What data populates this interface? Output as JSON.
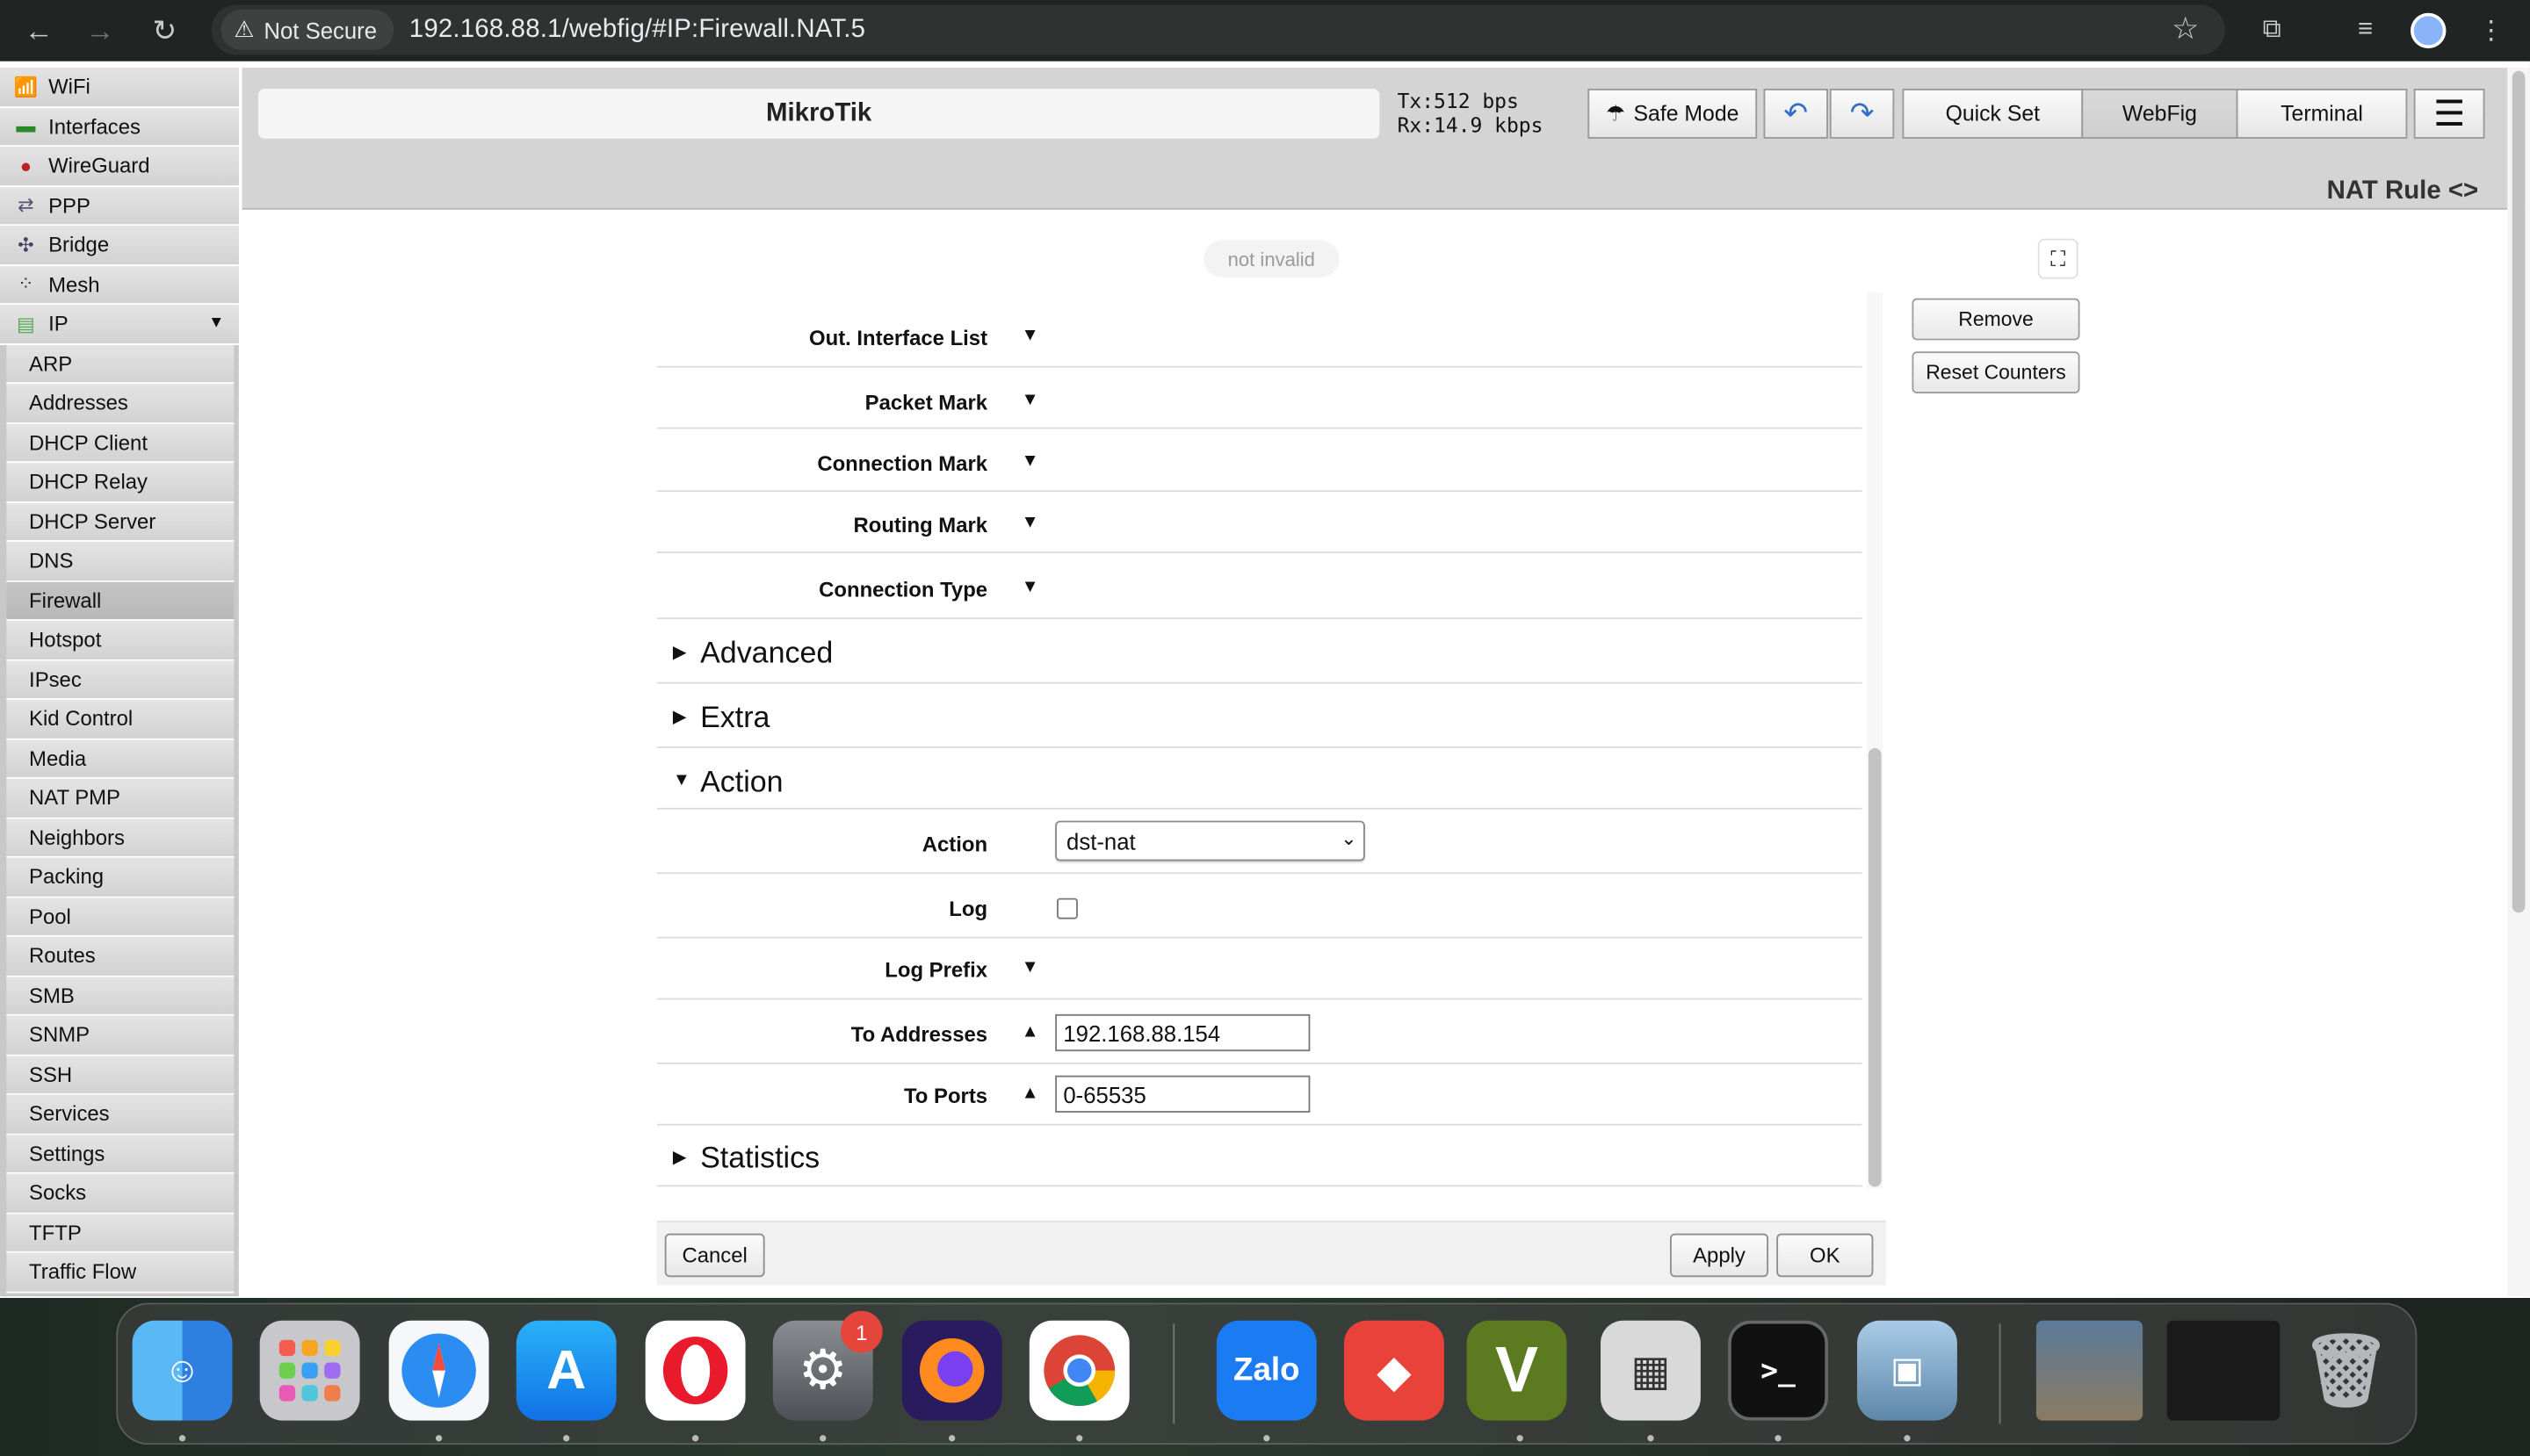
{
  "browser": {
    "security_label": "Not Secure",
    "url": "192.168.88.1/webfig/#IP:Firewall.NAT.5"
  },
  "sidebar": {
    "items": [
      {
        "label": "WiFi",
        "icon": "wifi-icon"
      },
      {
        "label": "Interfaces",
        "icon": "interfaces-icon"
      },
      {
        "label": "WireGuard",
        "icon": "wireguard-icon"
      },
      {
        "label": "PPP",
        "icon": "ppp-icon"
      },
      {
        "label": "Bridge",
        "icon": "bridge-icon"
      },
      {
        "label": "Mesh",
        "icon": "mesh-icon"
      },
      {
        "label": "IP",
        "icon": "ip-icon"
      }
    ],
    "ip_submenu": [
      "ARP",
      "Addresses",
      "DHCP Client",
      "DHCP Relay",
      "DHCP Server",
      "DNS",
      "Firewall",
      "Hotspot",
      "IPsec",
      "Kid Control",
      "Media",
      "NAT PMP",
      "Neighbors",
      "Packing",
      "Pool",
      "Routes",
      "SMB",
      "SNMP",
      "SSH",
      "Services",
      "Settings",
      "Socks",
      "TFTP",
      "Traffic Flow"
    ],
    "active": "Firewall"
  },
  "header": {
    "brand": "MikroTik",
    "tx": "Tx:512 bps",
    "rx": "Rx:14.9 kbps",
    "safe_mode": "Safe Mode",
    "quick_set": "Quick Set",
    "webfig": "WebFig",
    "terminal": "Terminal",
    "panel_title": "NAT Rule <>"
  },
  "status": "not invalid",
  "side_buttons": {
    "remove": "Remove",
    "reset_counters": "Reset Counters"
  },
  "fields": {
    "out_interface_list": "Out. Interface List",
    "packet_mark": "Packet Mark",
    "connection_mark": "Connection Mark",
    "routing_mark": "Routing Mark",
    "connection_type": "Connection Type"
  },
  "sections": {
    "advanced": "Advanced",
    "extra": "Extra",
    "action": "Action",
    "statistics": "Statistics"
  },
  "action": {
    "action_label": "Action",
    "action_value": "dst-nat",
    "log_label": "Log",
    "log_checked": false,
    "log_prefix_label": "Log Prefix",
    "to_addresses_label": "To Addresses",
    "to_addresses_value": "192.168.88.154",
    "to_ports_label": "To Ports",
    "to_ports_value": "0-65535"
  },
  "footer": {
    "cancel": "Cancel",
    "apply": "Apply",
    "ok": "OK"
  },
  "dock": {
    "apps": [
      "Finder",
      "Launchpad",
      "Safari",
      "App Store",
      "Opera",
      "System Settings",
      "Firefox",
      "Chrome",
      "Zalo",
      "AnyDesk",
      "Vim",
      "Calculator",
      "Terminal",
      "Preview"
    ],
    "zalo_label": "Zalo",
    "vim_label": "V",
    "settings_badge": "1"
  }
}
